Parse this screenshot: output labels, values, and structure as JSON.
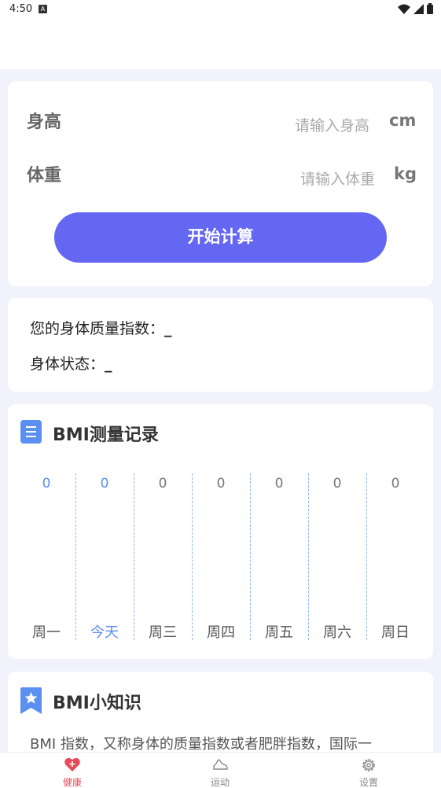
{
  "status": {
    "time": "4:50",
    "a_badge": "A"
  },
  "inputs": {
    "height": {
      "label": "身高",
      "placeholder": "请输入身高",
      "unit": "cm"
    },
    "weight": {
      "label": "体重",
      "placeholder": "请输入体重",
      "unit": "kg"
    },
    "calculate_label": "开始计算"
  },
  "result": {
    "bmi_label": "您的身体质量指数：",
    "bmi_value": "_",
    "status_label": "身体状态：",
    "status_value": "_"
  },
  "record": {
    "title": "BMI测量记录",
    "columns": [
      {
        "day": "周一",
        "value": "0"
      },
      {
        "day": "今天",
        "value": "0"
      },
      {
        "day": "周三",
        "value": "0"
      },
      {
        "day": "周四",
        "value": "0"
      },
      {
        "day": "周五",
        "value": "0"
      },
      {
        "day": "周六",
        "value": "0"
      },
      {
        "day": "周日",
        "value": "0"
      }
    ]
  },
  "knowledge": {
    "title": "BMI小知识",
    "text": "BMI 指数，又称身体的质量指数或者肥胖指数，国际一"
  },
  "tabs": [
    {
      "label": "健康",
      "icon": "heart-plus-icon"
    },
    {
      "label": "运动",
      "icon": "sneaker-icon"
    },
    {
      "label": "设置",
      "icon": "gear-icon"
    }
  ],
  "colors": {
    "accent": "#6467f2",
    "chart_blue": "#5b8ff0",
    "tab_active": "#e84b5a",
    "background": "#f1f2fb"
  }
}
